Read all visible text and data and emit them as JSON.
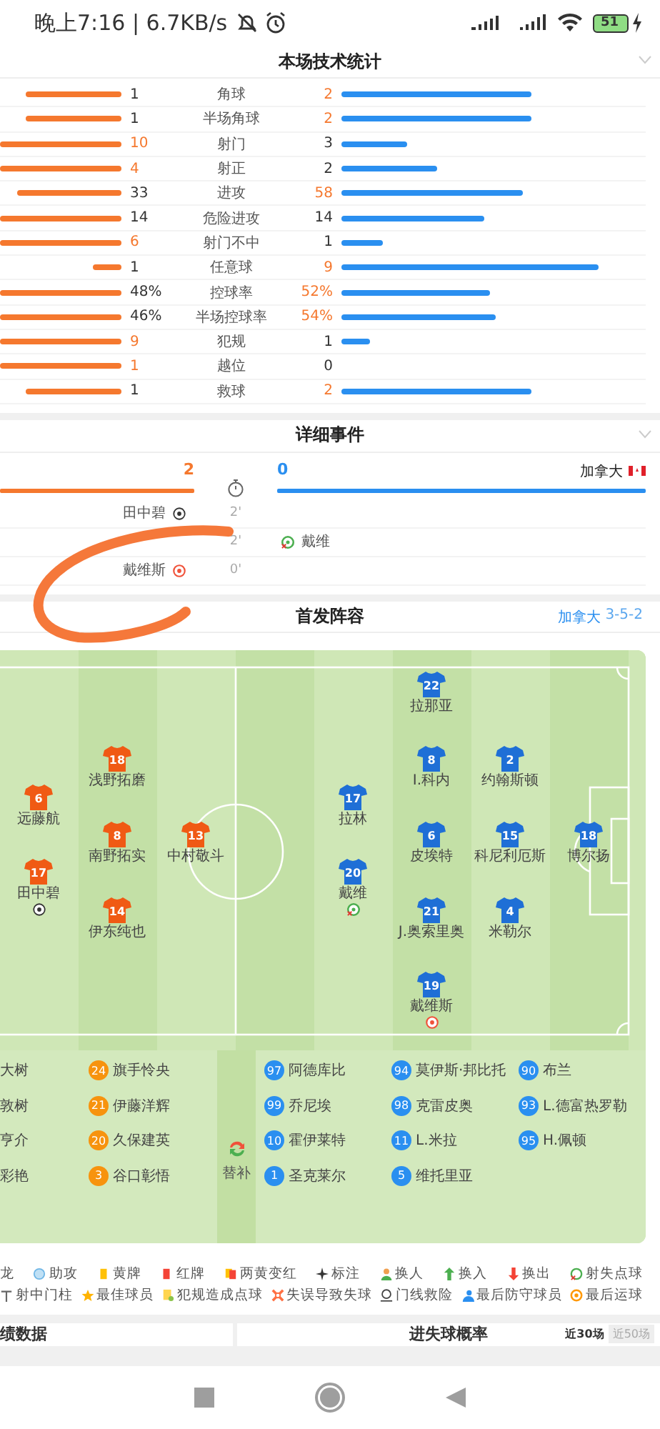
{
  "status_bar": {
    "time": "晚上7:16 | 6.7KB/s",
    "battery": "51"
  },
  "stats": {
    "title": "本场技术统计",
    "rows": [
      {
        "label": "角球",
        "home": {
          "value": "1",
          "highlighted": false
        },
        "away": {
          "value": "2",
          "highlighted": true
        }
      },
      {
        "label": "半场角球",
        "home": {
          "value": "1",
          "highlighted": false
        },
        "away": {
          "value": "2",
          "highlighted": true
        }
      },
      {
        "label": "射门",
        "home": {
          "value": "10",
          "highlighted": true
        },
        "away": {
          "value": "3",
          "highlighted": false
        }
      },
      {
        "label": "射正",
        "home": {
          "value": "4",
          "highlighted": true
        },
        "away": {
          "value": "2",
          "highlighted": false
        }
      },
      {
        "label": "进攻",
        "home": {
          "value": "33",
          "highlighted": false
        },
        "away": {
          "value": "58",
          "highlighted": true
        }
      },
      {
        "label": "危险进攻",
        "home": {
          "value": "14",
          "highlighted": false
        },
        "away": {
          "value": "14",
          "highlighted": false
        }
      },
      {
        "label": "射门不中",
        "home": {
          "value": "6",
          "highlighted": true
        },
        "away": {
          "value": "1",
          "highlighted": false
        }
      },
      {
        "label": "任意球",
        "home": {
          "value": "1",
          "highlighted": false
        },
        "away": {
          "value": "9",
          "highlighted": true
        }
      },
      {
        "label": "控球率",
        "home": {
          "value": "48%",
          "highlighted": false
        },
        "away": {
          "value": "52%",
          "highlighted": true
        }
      },
      {
        "label": "半场控球率",
        "home": {
          "value": "46%",
          "highlighted": false
        },
        "away": {
          "value": "54%",
          "highlighted": true
        }
      },
      {
        "label": "犯规",
        "home": {
          "value": "9",
          "highlighted": true
        },
        "away": {
          "value": "1",
          "highlighted": false
        }
      },
      {
        "label": "越位",
        "home": {
          "value": "1",
          "highlighted": true
        },
        "away": {
          "value": "0",
          "highlighted": false
        }
      },
      {
        "label": "救球",
        "home": {
          "value": "1",
          "highlighted": false
        },
        "away": {
          "value": "2",
          "highlighted": true
        }
      }
    ]
  },
  "events": {
    "title": "详细事件",
    "home_score": "2",
    "away_score": "0",
    "away_team": "加拿大",
    "rows": [
      {
        "minute": "2'",
        "home": {
          "player": "田中碧",
          "kind": "goal"
        }
      },
      {
        "minute": "2'",
        "away": {
          "player": "戴维",
          "kind": "missed_penalty"
        }
      },
      {
        "minute": "0'",
        "home": {
          "player": "戴维斯",
          "kind": "own_goal"
        }
      }
    ]
  },
  "lineup": {
    "title": "首发阵容",
    "away_team": "加拿大",
    "away_formation": "3-5-2",
    "home_lines": [
      [
        {
          "number": "6",
          "name": "远藤航"
        },
        {
          "number": "17",
          "name": "田中碧",
          "kind": "goal"
        }
      ],
      [
        {
          "number": "18",
          "name": "浅野拓磨"
        },
        {
          "number": "8",
          "name": "南野拓实"
        },
        {
          "number": "14",
          "name": "伊东纯也"
        }
      ],
      [
        {
          "number": "13",
          "name": "中村敬斗"
        }
      ]
    ],
    "away_lines": [
      [
        {
          "number": "17",
          "name": "拉林"
        },
        {
          "number": "20",
          "name": "戴维",
          "kind": "missed_penalty"
        }
      ],
      [
        {
          "number": "22",
          "name": "拉那亚"
        },
        {
          "number": "8",
          "name": "I.科内"
        },
        {
          "number": "6",
          "name": "皮埃特"
        },
        {
          "number": "21",
          "name": "J.奥索里奥"
        },
        {
          "number": "19",
          "name": "戴维斯",
          "kind": "own_goal"
        }
      ],
      [
        {
          "number": "2",
          "name": "约翰斯顿"
        },
        {
          "number": "15",
          "name": "科尼利厄斯"
        },
        {
          "number": "4",
          "name": "米勒尔"
        }
      ],
      [
        {
          "number": "18",
          "name": "博尔扬"
        }
      ]
    ],
    "subs_label": "替补",
    "home_sub_columns": [
      [
        {
          "name": "大树"
        },
        {
          "name": "敦树"
        },
        {
          "name": "亨介"
        },
        {
          "name": "彩艳"
        }
      ],
      [
        {
          "number": "24",
          "name": "旗手怜央"
        },
        {
          "number": "21",
          "name": "伊藤洋辉"
        },
        {
          "number": "20",
          "name": "久保建英"
        },
        {
          "number": "3",
          "name": "谷口彰悟"
        }
      ]
    ],
    "away_sub_columns": [
      [
        {
          "number": "97",
          "name": "阿德库比"
        },
        {
          "number": "99",
          "name": "乔尼埃"
        },
        {
          "number": "10",
          "name": "霍伊莱特"
        },
        {
          "number": "1",
          "name": "圣克莱尔"
        }
      ],
      [
        {
          "number": "94",
          "name": "莫伊斯·邦比托"
        },
        {
          "number": "98",
          "name": "克雷皮奥"
        },
        {
          "number": "11",
          "name": "L.米拉"
        },
        {
          "number": "5",
          "name": "维托里亚"
        }
      ],
      [
        {
          "number": "90",
          "name": "布兰"
        },
        {
          "number": "93",
          "name": "L.德富热罗勒"
        },
        {
          "number": "95",
          "name": "H.佩顿"
        }
      ]
    ]
  },
  "legend": [
    [
      {
        "label": "龙"
      },
      {
        "label": "助攻",
        "kind": "assist"
      },
      {
        "label": "黄牌",
        "kind": "yellow"
      },
      {
        "label": "红牌",
        "kind": "red"
      },
      {
        "label": "两黄变红",
        "kind": "second_yellow"
      },
      {
        "label": "标注",
        "kind": "mark"
      },
      {
        "label": "换人",
        "kind": "sub"
      },
      {
        "label": "换入",
        "kind": "sub_in"
      },
      {
        "label": "换出",
        "kind": "sub_out"
      },
      {
        "label": "射失点球",
        "kind": "missed_penalty"
      }
    ],
    [
      {
        "label": "射中门柱",
        "kind": "post"
      },
      {
        "label": "最佳球员",
        "kind": "best"
      },
      {
        "label": "犯规造成点球",
        "kind": "penalty_foul"
      },
      {
        "label": "失误导致失球",
        "kind": "error"
      },
      {
        "label": "门线救险",
        "kind": "line_clear"
      },
      {
        "label": "最后防守球员",
        "kind": "last_defender"
      },
      {
        "label": "最后运球",
        "kind": "last_dribble"
      }
    ]
  ],
  "bottom": {
    "left_title": "绩数据",
    "right_title": "进失球概率",
    "tabs": [
      {
        "label": "近30场",
        "selected": true
      },
      {
        "label": "近50场",
        "selected": false
      }
    ]
  }
}
